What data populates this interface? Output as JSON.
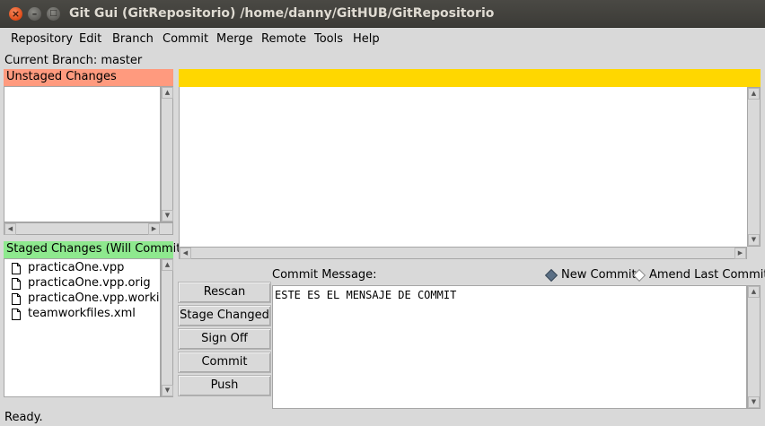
{
  "window": {
    "title": "Git Gui (GitRepositorio) /home/danny/GitHUB/GitRepositorio",
    "close_glyph": "×",
    "min_glyph": "–",
    "max_glyph": "□"
  },
  "menubar": {
    "items": [
      "Repository",
      "Edit",
      "Branch",
      "Commit",
      "Merge",
      "Remote",
      "Tools",
      "Help"
    ]
  },
  "branch": {
    "label": "Current Branch: master"
  },
  "unstaged": {
    "header": "Unstaged Changes",
    "header_color": "#ff9a7e",
    "files": []
  },
  "staged": {
    "header": "Staged Changes (Will Commit)",
    "header_color": "#8ee98e",
    "files": [
      "practicaOne.vpp",
      "practicaOne.vpp.orig",
      "practicaOne.vpp.working",
      "teamworkfiles.xml"
    ]
  },
  "diff": {
    "header_color": "#ffd700"
  },
  "commit": {
    "label": "Commit Message:",
    "mode_new": "New Commit",
    "mode_amend": "Amend Last Commit",
    "selected_mode": "New Commit",
    "message": "ESTE ES EL MENSAJE DE COMMIT"
  },
  "buttons": {
    "rescan": "Rescan",
    "stage_changed": "Stage Changed",
    "sign_off": "Sign Off",
    "commit": "Commit",
    "push": "Push"
  },
  "status": {
    "text": "Ready."
  },
  "icons": {
    "scroll_up": "▲",
    "scroll_down": "▼",
    "scroll_left": "◀",
    "scroll_right": "▶"
  }
}
